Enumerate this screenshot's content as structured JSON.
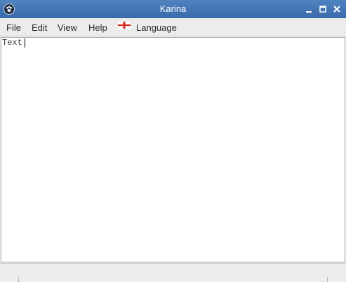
{
  "window": {
    "title": "Karina",
    "title_color": "#ffffff",
    "titlebar_color": "#4577b5"
  },
  "menu": {
    "file": "File",
    "edit": "Edit",
    "view": "View",
    "help": "Help",
    "language": "Language",
    "language_icon": "england-flag-icon"
  },
  "editor": {
    "content": "Text",
    "background": "#ffffff"
  }
}
